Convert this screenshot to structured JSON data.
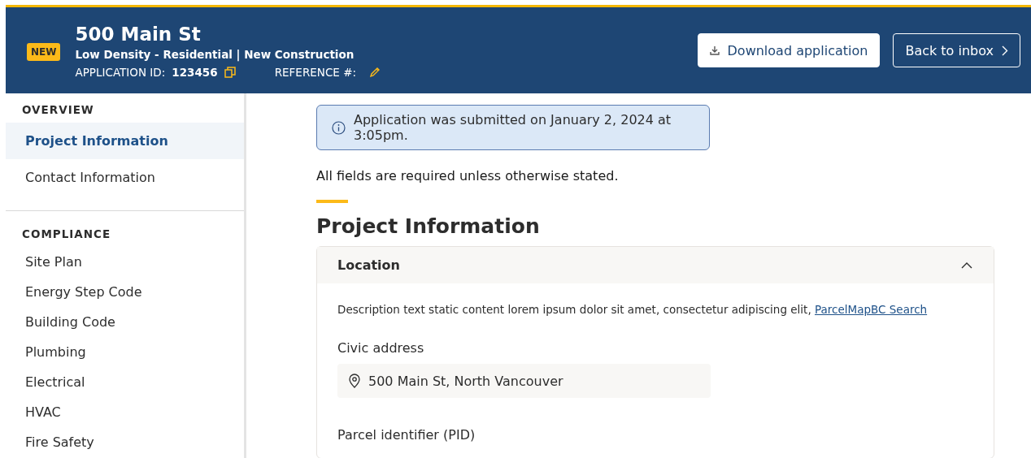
{
  "header": {
    "badge": "NEW",
    "title": "500 Main St",
    "subtitle": "Low Density - Residential | New Construction",
    "application_id_label": "APPLICATION ID:",
    "application_id": "123456",
    "reference_label": "REFERENCE #:",
    "buttons": [
      {
        "label": "Download application",
        "kind": "primary"
      },
      {
        "label": "Back to inbox",
        "kind": "outline"
      }
    ]
  },
  "sidebar": {
    "sections": [
      {
        "heading": "OVERVIEW",
        "items": [
          {
            "label": "Project Information",
            "selected": true
          },
          {
            "label": "Contact Information",
            "selected": false
          }
        ]
      },
      {
        "heading": "COMPLIANCE",
        "items": [
          {
            "label": "Site Plan",
            "selected": false
          },
          {
            "label": "Energy Step Code",
            "selected": false
          },
          {
            "label": "Building Code",
            "selected": false
          },
          {
            "label": "Plumbing",
            "selected": false
          },
          {
            "label": "Electrical",
            "selected": false
          },
          {
            "label": "HVAC",
            "selected": false
          },
          {
            "label": "Fire Safety",
            "selected": false
          }
        ]
      }
    ]
  },
  "main": {
    "alert": "Application was submitted on January 2, 2024 at 3:05pm.",
    "note": "All fields are required unless otherwise stated.",
    "heading": "Project Information",
    "panel": {
      "title": "Location",
      "expanded": true,
      "description": "Description text static content lorem ipsum dolor sit amet, consectetur adipiscing elit,",
      "link": "ParcelMapBC Search",
      "fields": [
        {
          "label": "Civic address",
          "value": "500 Main St, North Vancouver"
        },
        {
          "label": "Parcel identifier (PID)"
        }
      ]
    }
  }
}
